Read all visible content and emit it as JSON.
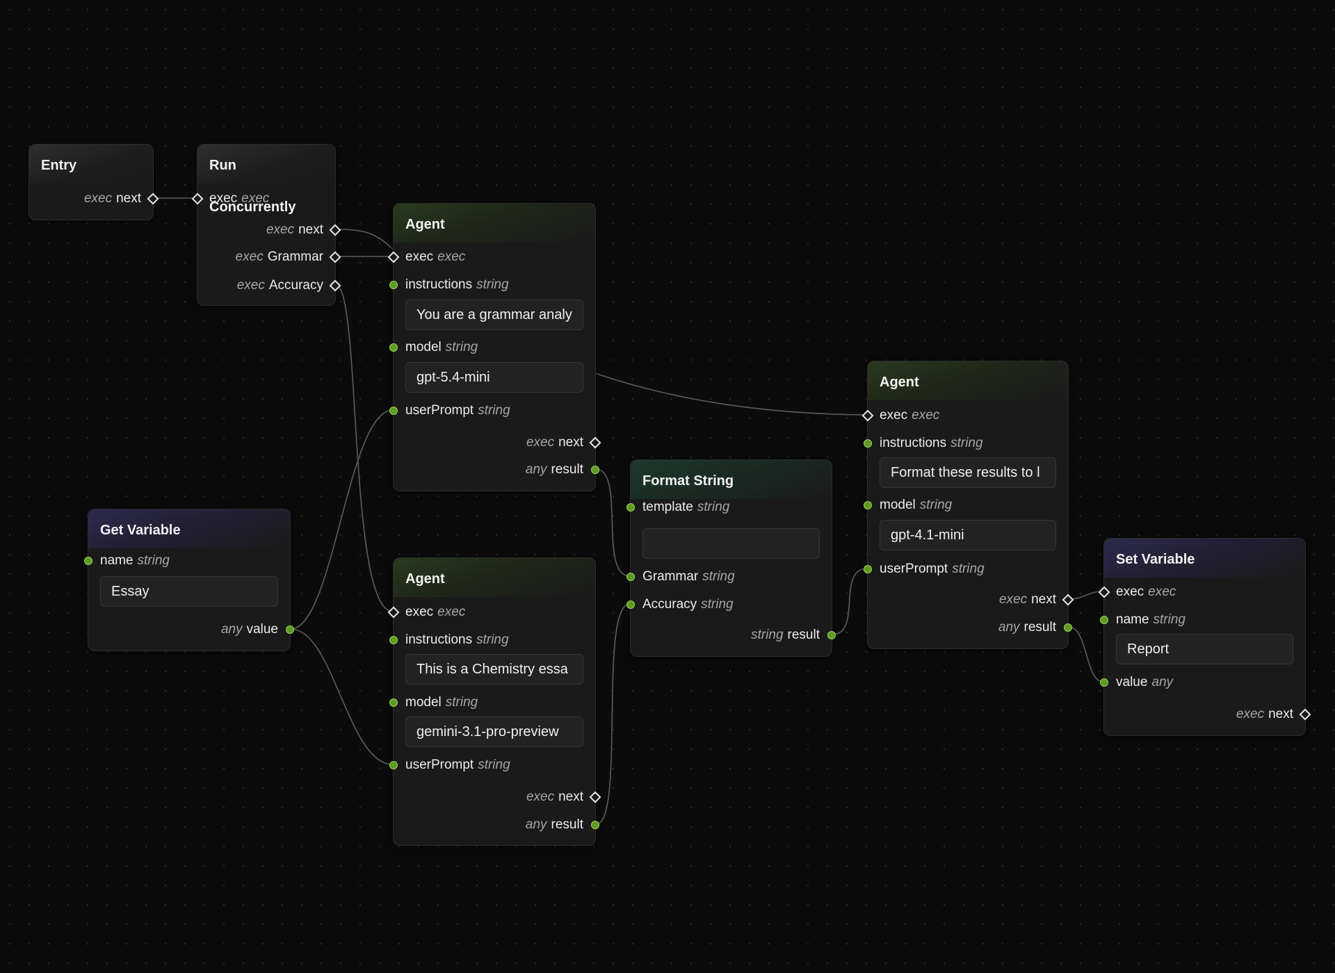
{
  "nodes": {
    "entry": {
      "title": "Entry",
      "out_exec": {
        "type": "exec",
        "label": "next"
      }
    },
    "run_concurrently": {
      "title": "Run Concurrently",
      "in_exec": {
        "label": "exec",
        "type": "exec"
      },
      "outs": [
        {
          "type": "exec",
          "label": "next"
        },
        {
          "type": "exec",
          "label": "Grammar"
        },
        {
          "type": "exec",
          "label": "Accuracy"
        }
      ]
    },
    "agent_grammar": {
      "title": "Agent",
      "in_exec": {
        "label": "exec",
        "type": "exec"
      },
      "instructions": {
        "label": "instructions",
        "type": "string",
        "value": "You are a grammar analy"
      },
      "model": {
        "label": "model",
        "type": "string",
        "value": "gpt-5.4-mini"
      },
      "userPrompt": {
        "label": "userPrompt",
        "type": "string"
      },
      "out_exec": {
        "type": "exec",
        "label": "next"
      },
      "out_result": {
        "type": "any",
        "label": "result"
      }
    },
    "agent_accuracy": {
      "title": "Agent",
      "in_exec": {
        "label": "exec",
        "type": "exec"
      },
      "instructions": {
        "label": "instructions",
        "type": "string",
        "value": "This is a Chemistry essa"
      },
      "model": {
        "label": "model",
        "type": "string",
        "value": "gemini-3.1-pro-preview"
      },
      "userPrompt": {
        "label": "userPrompt",
        "type": "string"
      },
      "out_exec": {
        "type": "exec",
        "label": "next"
      },
      "out_result": {
        "type": "any",
        "label": "result"
      }
    },
    "get_variable": {
      "title": "Get Variable",
      "name": {
        "label": "name",
        "type": "string",
        "value": "Essay"
      },
      "out_value": {
        "type": "any",
        "label": "value"
      }
    },
    "format_string": {
      "title": "Format String",
      "template": {
        "label": "template",
        "type": "string",
        "value": ""
      },
      "grammar": {
        "label": "Grammar",
        "type": "string"
      },
      "accuracy": {
        "label": "Accuracy",
        "type": "string"
      },
      "out_result": {
        "type": "string",
        "label": "result"
      }
    },
    "agent_final": {
      "title": "Agent",
      "in_exec": {
        "label": "exec",
        "type": "exec"
      },
      "instructions": {
        "label": "instructions",
        "type": "string",
        "value": "Format these results to l"
      },
      "model": {
        "label": "model",
        "type": "string",
        "value": "gpt-4.1-mini"
      },
      "userPrompt": {
        "label": "userPrompt",
        "type": "string"
      },
      "out_exec": {
        "type": "exec",
        "label": "next"
      },
      "out_result": {
        "type": "any",
        "label": "result"
      }
    },
    "set_variable": {
      "title": "Set Variable",
      "in_exec": {
        "label": "exec",
        "type": "exec"
      },
      "name": {
        "label": "name",
        "type": "string",
        "value": "Report"
      },
      "value": {
        "label": "value",
        "type": "any"
      },
      "out_exec": {
        "type": "exec",
        "label": "next"
      }
    }
  }
}
